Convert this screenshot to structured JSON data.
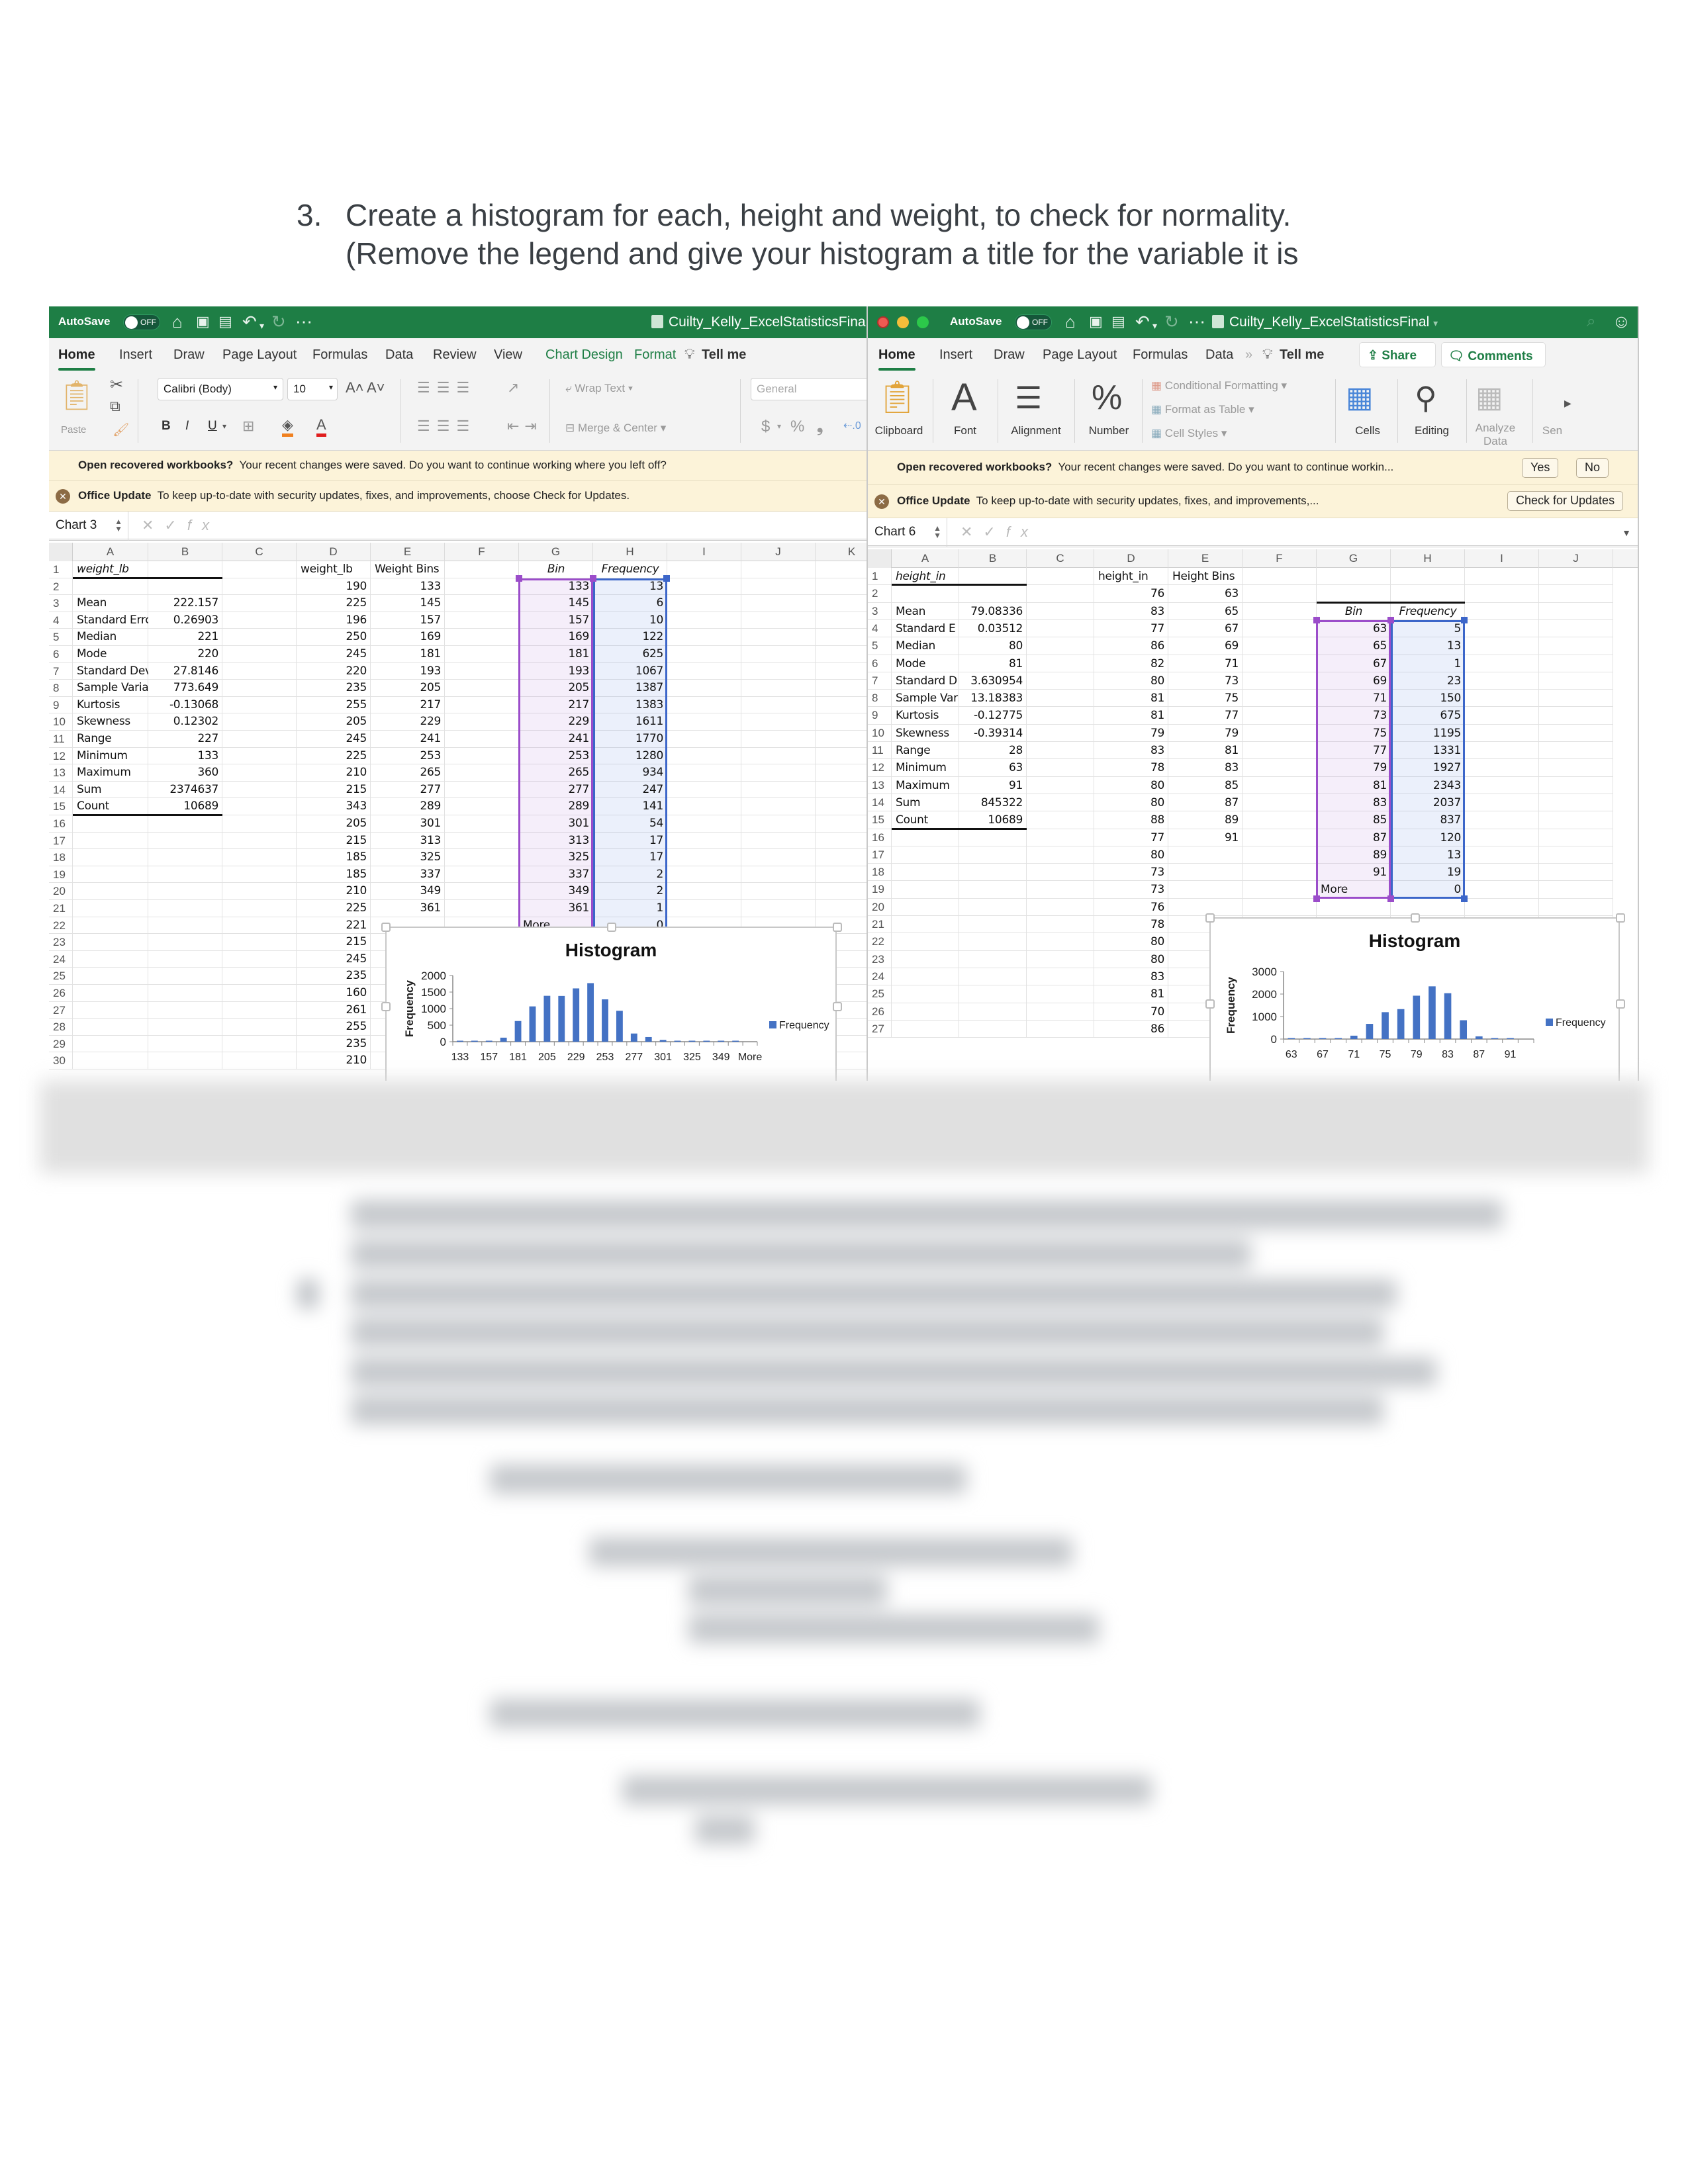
{
  "document": {
    "step_number": "3.",
    "step_line1": "Create a histogram for each, height and weight, to check for normality.",
    "step_line2": "(Remove the legend and give your histogram a title for the variable it is"
  },
  "left_window": {
    "autosave_label": "AutoSave",
    "autosave_state": "OFF",
    "file_title": "Cuilty_Kelly_ExcelStatisticsFinal",
    "tabs": [
      "Home",
      "Insert",
      "Draw",
      "Page Layout",
      "Formulas",
      "Data",
      "Review",
      "View",
      "Chart Design",
      "Format",
      "Tell me"
    ],
    "active_tab": "Home",
    "ribbon": {
      "paste_label": "Paste",
      "font_name": "Calibri (Body)",
      "font_size": "10",
      "grow_font": "A˄",
      "shrink_font": "A˅",
      "bold": "B",
      "italic": "I",
      "underline": "U",
      "wrap_text": "Wrap Text",
      "merge_center": "Merge & Center",
      "number_format": "General",
      "currency": "$",
      "percent": "%",
      "comma": "9"
    },
    "banner_recover": {
      "title": "Open recovered workbooks?",
      "message": "Your recent changes were saved. Do you want to continue working where you left off?"
    },
    "banner_update": {
      "title": "Office Update",
      "message": "To keep up-to-date with security updates, fixes, and improvements, choose Check for Updates."
    },
    "name_box": "Chart 3",
    "columns": [
      "A",
      "B",
      "C",
      "D",
      "E",
      "F",
      "G",
      "H",
      "I",
      "J",
      "K"
    ],
    "rows": [
      "1",
      "2",
      "3",
      "4",
      "5",
      "6",
      "7",
      "8",
      "9",
      "10",
      "11",
      "12",
      "13",
      "14",
      "15",
      "16",
      "17",
      "18",
      "19",
      "20",
      "21",
      "22",
      "23",
      "24",
      "25",
      "26",
      "27",
      "28",
      "29",
      "30"
    ],
    "stats_header": "weight_lb",
    "stats": [
      {
        "label": "Mean",
        "value": "222.157"
      },
      {
        "label": "Standard Errc",
        "value": "0.26903"
      },
      {
        "label": "Median",
        "value": "221"
      },
      {
        "label": "Mode",
        "value": "220"
      },
      {
        "label": "Standard Dev",
        "value": "27.8146"
      },
      {
        "label": "Sample Variar",
        "value": "773.649"
      },
      {
        "label": "Kurtosis",
        "value": "-0.13068"
      },
      {
        "label": "Skewness",
        "value": "0.12302"
      },
      {
        "label": "Range",
        "value": "227"
      },
      {
        "label": "Minimum",
        "value": "133"
      },
      {
        "label": "Maximum",
        "value": "360"
      },
      {
        "label": "Sum",
        "value": "2374637"
      },
      {
        "label": "Count",
        "value": "10689"
      }
    ],
    "col_d_header": "weight_lb",
    "col_d_values": [
      "190",
      "225",
      "196",
      "250",
      "245",
      "220",
      "235",
      "255",
      "205",
      "245",
      "225",
      "210",
      "215",
      "343",
      "205",
      "215",
      "185",
      "185",
      "210",
      "225",
      "221",
      "215",
      "245",
      "235",
      "160",
      "261",
      "255",
      "235",
      "210"
    ],
    "col_e_header": "Weight Bins",
    "col_e_values": [
      "133",
      "145",
      "157",
      "169",
      "181",
      "193",
      "205",
      "217",
      "229",
      "241",
      "253",
      "265",
      "277",
      "289",
      "301",
      "313",
      "325",
      "337",
      "349",
      "361"
    ],
    "bin_header": "Bin",
    "freq_header": "Frequency",
    "bins": [
      "133",
      "145",
      "157",
      "169",
      "181",
      "193",
      "205",
      "217",
      "229",
      "241",
      "253",
      "265",
      "277",
      "289",
      "301",
      "313",
      "325",
      "337",
      "349",
      "361",
      "More"
    ],
    "frequencies": [
      "13",
      "6",
      "10",
      "122",
      "625",
      "1067",
      "1387",
      "1383",
      "1611",
      "1770",
      "1280",
      "934",
      "247",
      "141",
      "54",
      "17",
      "17",
      "2",
      "2",
      "1",
      "0"
    ]
  },
  "right_window": {
    "autosave_label": "AutoSave",
    "autosave_state": "OFF",
    "file_title": "Cuilty_Kelly_ExcelStatisticsFinal",
    "tabs": [
      "Home",
      "Insert",
      "Draw",
      "Page Layout",
      "Formulas",
      "Data",
      "Tell me"
    ],
    "active_tab": "Home",
    "share_label": "Share",
    "comments_label": "Comments",
    "ribbon": {
      "clipboard": "Clipboard",
      "font": "Font",
      "alignment": "Alignment",
      "number": "Number",
      "conditional_formatting": "Conditional Formatting",
      "format_as_table": "Format as Table",
      "cell_styles": "Cell Styles",
      "cells": "Cells",
      "editing": "Editing",
      "analyze_data": "Analyze Data",
      "sensitivity_partial": "Sen"
    },
    "banner_recover": {
      "title": "Open recovered workbooks?",
      "message": "Your recent changes were saved. Do you want to continue workin...",
      "yes_label": "Yes",
      "no_label": "No"
    },
    "banner_update": {
      "title": "Office Update",
      "message": "To keep up-to-date with security updates, fixes, and improvements,...",
      "button_label": "Check for Updates"
    },
    "name_box": "Chart 6",
    "columns": [
      "A",
      "B",
      "C",
      "D",
      "E",
      "F",
      "G",
      "H",
      "I",
      "J"
    ],
    "rows": [
      "1",
      "2",
      "3",
      "4",
      "5",
      "6",
      "7",
      "8",
      "9",
      "10",
      "11",
      "12",
      "13",
      "14",
      "15",
      "16",
      "17",
      "18",
      "19",
      "20",
      "21",
      "22",
      "23",
      "24",
      "25",
      "26",
      "27"
    ],
    "stats_header": "height_in",
    "stats": [
      {
        "label": "Mean",
        "value": "79.08336"
      },
      {
        "label": "Standard E",
        "value": "0.03512"
      },
      {
        "label": "Median",
        "value": "80"
      },
      {
        "label": "Mode",
        "value": "81"
      },
      {
        "label": "Standard D",
        "value": "3.630954"
      },
      {
        "label": "Sample Var",
        "value": "13.18383"
      },
      {
        "label": "Kurtosis",
        "value": "-0.12775"
      },
      {
        "label": "Skewness",
        "value": "-0.39314"
      },
      {
        "label": "Range",
        "value": "28"
      },
      {
        "label": "Minimum",
        "value": "63"
      },
      {
        "label": "Maximum",
        "value": "91"
      },
      {
        "label": "Sum",
        "value": "845322"
      },
      {
        "label": "Count",
        "value": "10689"
      }
    ],
    "col_d_header": "height_in",
    "col_d_values": [
      "76",
      "83",
      "77",
      "86",
      "82",
      "80",
      "81",
      "81",
      "79",
      "83",
      "78",
      "80",
      "80",
      "88",
      "77",
      "80",
      "73",
      "73",
      "76",
      "78",
      "80",
      "80",
      "83",
      "81",
      "70",
      "86"
    ],
    "col_e_header": "Height Bins",
    "col_e_values": [
      "63",
      "65",
      "67",
      "69",
      "71",
      "73",
      "75",
      "77",
      "79",
      "81",
      "83",
      "85",
      "87",
      "89",
      "91"
    ],
    "bin_header": "Bin",
    "freq_header": "Frequency",
    "bins": [
      "63",
      "65",
      "67",
      "69",
      "71",
      "73",
      "75",
      "77",
      "79",
      "81",
      "83",
      "85",
      "87",
      "89",
      "91",
      "More"
    ],
    "frequencies": [
      "5",
      "13",
      "1",
      "23",
      "150",
      "675",
      "1195",
      "1331",
      "1927",
      "2343",
      "2037",
      "837",
      "120",
      "13",
      "19",
      "0"
    ]
  },
  "chart_data": [
    {
      "type": "bar",
      "title": "Histogram",
      "xlabel": "",
      "ylabel": "Frequency",
      "categories": [
        "133",
        "145",
        "157",
        "169",
        "181",
        "193",
        "205",
        "217",
        "229",
        "241",
        "253",
        "265",
        "277",
        "289",
        "301",
        "313",
        "325",
        "337",
        "349",
        "361",
        "More"
      ],
      "tick_labels": [
        "133",
        "157",
        "181",
        "205",
        "229",
        "253",
        "277",
        "301",
        "325",
        "349",
        "More"
      ],
      "series": [
        {
          "name": "Frequency",
          "values": [
            13,
            6,
            10,
            122,
            625,
            1067,
            1387,
            1383,
            1611,
            1770,
            1280,
            934,
            247,
            141,
            54,
            17,
            17,
            2,
            2,
            1,
            0
          ]
        }
      ],
      "yticks": [
        0,
        500,
        1000,
        1500,
        2000
      ],
      "ylim": [
        0,
        2000
      ],
      "legend": "right",
      "color": "#4472c4"
    },
    {
      "type": "bar",
      "title": "Histogram",
      "xlabel": "",
      "ylabel": "Frequency",
      "categories": [
        "63",
        "65",
        "67",
        "69",
        "71",
        "73",
        "75",
        "77",
        "79",
        "81",
        "83",
        "85",
        "87",
        "89",
        "91",
        "More"
      ],
      "tick_labels": [
        "63",
        "67",
        "71",
        "75",
        "79",
        "83",
        "87",
        "91"
      ],
      "series": [
        {
          "name": "Frequency",
          "values": [
            5,
            13,
            1,
            23,
            150,
            675,
            1195,
            1331,
            1927,
            2343,
            2037,
            837,
            120,
            13,
            19,
            0
          ]
        }
      ],
      "yticks": [
        0,
        1000,
        2000,
        3000
      ],
      "ylim": [
        0,
        3000
      ],
      "legend": "right",
      "color": "#4472c4"
    }
  ]
}
